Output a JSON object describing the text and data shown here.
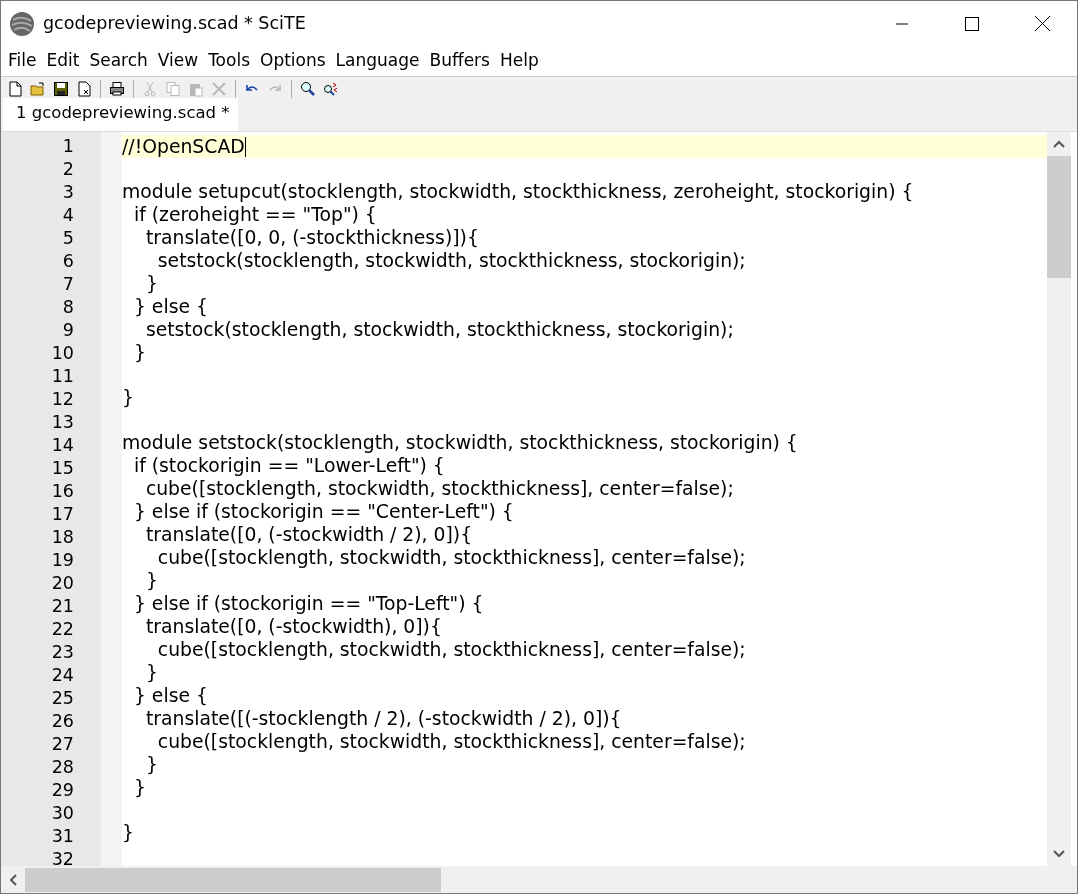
{
  "window": {
    "title": "gcodepreviewing.scad * SciTE"
  },
  "menu": [
    "File",
    "Edit",
    "Search",
    "View",
    "Tools",
    "Options",
    "Language",
    "Buffers",
    "Help"
  ],
  "toolbar": [
    {
      "kind": "new",
      "disabled": false
    },
    {
      "kind": "open",
      "disabled": false
    },
    {
      "kind": "save",
      "disabled": false
    },
    {
      "kind": "close",
      "disabled": false
    },
    {
      "kind": "sep"
    },
    {
      "kind": "print",
      "disabled": false
    },
    {
      "kind": "sep"
    },
    {
      "kind": "cut",
      "disabled": true
    },
    {
      "kind": "copy",
      "disabled": true
    },
    {
      "kind": "paste",
      "disabled": true
    },
    {
      "kind": "delete",
      "disabled": true
    },
    {
      "kind": "sep"
    },
    {
      "kind": "undo",
      "disabled": false
    },
    {
      "kind": "redo",
      "disabled": true
    },
    {
      "kind": "sep"
    },
    {
      "kind": "find",
      "disabled": false
    },
    {
      "kind": "replace",
      "disabled": false
    }
  ],
  "tabs": [
    {
      "label": "1 gcodepreviewing.scad *",
      "selected": true
    }
  ],
  "lines": [
    {
      "number": "1",
      "text": "//!OpenSCAD",
      "current": true
    },
    {
      "number": "2",
      "current": false
    },
    {
      "number": "3",
      "text": "module setupcut(stocklength, stockwidth, stockthickness, zeroheight, stockorigin) {",
      "current": false
    },
    {
      "number": "4",
      "text": "  if (zeroheight == \"Top\") {",
      "current": false
    },
    {
      "number": "5",
      "text": "    translate([0, 0, (-stockthickness)]){",
      "current": false
    },
    {
      "number": "6",
      "text": "      setstock(stocklength, stockwidth, stockthickness, stockorigin);",
      "current": false
    },
    {
      "number": "7",
      "text": "    }",
      "current": false
    },
    {
      "number": "8",
      "text": "  } else {",
      "current": false
    },
    {
      "number": "9",
      "text": "    setstock(stocklength, stockwidth, stockthickness, stockorigin);",
      "current": false
    },
    {
      "number": "10",
      "text": "  }",
      "current": false
    },
    {
      "number": "11",
      "current": false
    },
    {
      "number": "12",
      "text": "}",
      "current": false
    },
    {
      "number": "13",
      "current": false
    },
    {
      "number": "14",
      "text": "module setstock(stocklength, stockwidth, stockthickness, stockorigin) {",
      "current": false
    },
    {
      "number": "15",
      "text": "  if (stockorigin == \"Lower-Left\") {",
      "current": false
    },
    {
      "number": "16",
      "text": "    cube([stocklength, stockwidth, stockthickness], center=false);",
      "current": false
    },
    {
      "number": "17",
      "text": "  } else if (stockorigin == \"Center-Left\") {",
      "current": false
    },
    {
      "number": "18",
      "text": "    translate([0, (-stockwidth / 2), 0]){",
      "current": false
    },
    {
      "number": "19",
      "text": "      cube([stocklength, stockwidth, stockthickness], center=false);",
      "current": false
    },
    {
      "number": "20",
      "text": "    }",
      "current": false
    },
    {
      "number": "21",
      "text": "  } else if (stockorigin == \"Top-Left\") {",
      "current": false
    },
    {
      "number": "22",
      "text": "    translate([0, (-stockwidth), 0]){",
      "current": false
    },
    {
      "number": "23",
      "text": "      cube([stocklength, stockwidth, stockthickness], center=false);",
      "current": false
    },
    {
      "number": "24",
      "text": "    }",
      "current": false
    },
    {
      "number": "25",
      "text": "  } else {",
      "current": false
    },
    {
      "number": "26",
      "text": "    translate([(-stocklength / 2), (-stockwidth / 2), 0]){",
      "current": false
    },
    {
      "number": "27",
      "text": "      cube([stocklength, stockwidth, stockthickness], center=false);",
      "current": false
    },
    {
      "number": "28",
      "text": "    }",
      "current": false
    },
    {
      "number": "29",
      "text": "  }",
      "current": false
    },
    {
      "number": "30",
      "current": false
    },
    {
      "number": "31",
      "text": "}",
      "current": false
    },
    {
      "number": "32",
      "current": false
    }
  ]
}
